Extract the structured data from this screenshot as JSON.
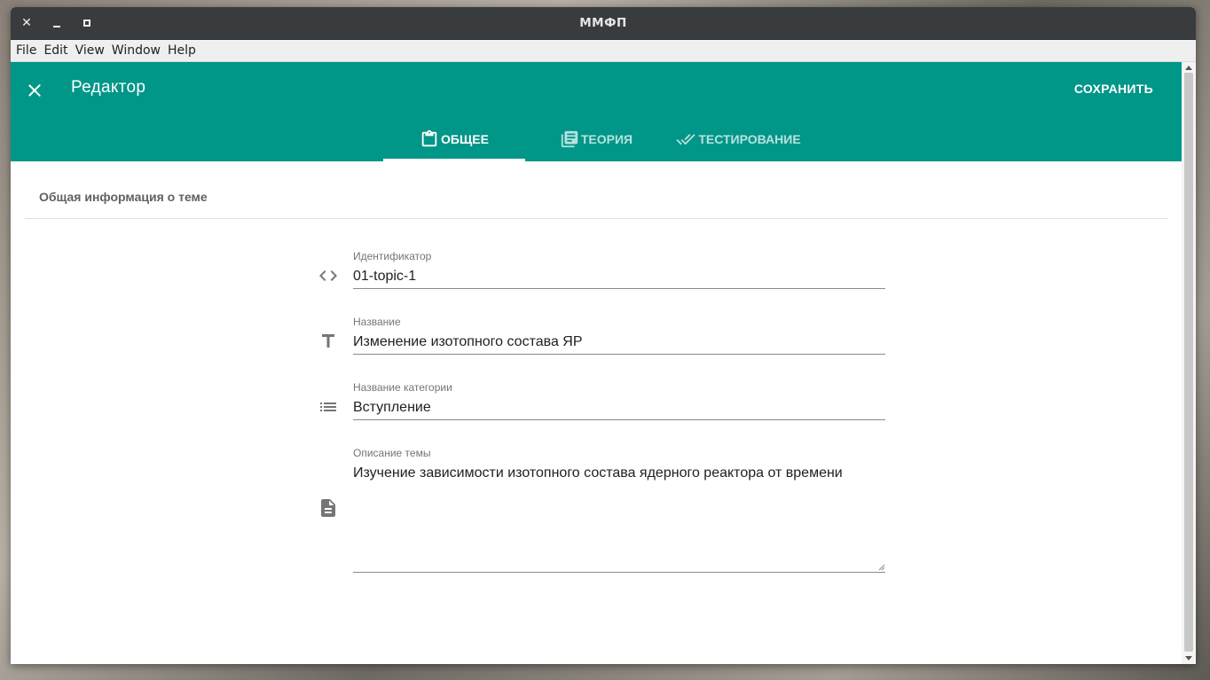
{
  "window": {
    "title": "ММФП"
  },
  "menubar": {
    "items": [
      "File",
      "Edit",
      "View",
      "Window",
      "Help"
    ]
  },
  "appbar": {
    "title": "Редактор",
    "save_label": "СОХРАНИТЬ",
    "close_icon": "close-icon",
    "color": "#009688"
  },
  "tabs": [
    {
      "label": "ОБЩЕЕ",
      "icon": "clipboard-icon",
      "active": true
    },
    {
      "label": "ТЕОРИЯ",
      "icon": "book-icon",
      "active": false
    },
    {
      "label": "ТЕСТИРОВАНИЕ",
      "icon": "double-check-icon",
      "active": false
    }
  ],
  "section": {
    "title": "Общая информация о теме"
  },
  "form": {
    "identifier": {
      "label": "Идентификатор",
      "value": "01-topic-1",
      "icon": "code-icon"
    },
    "name": {
      "label": "Название",
      "value": "Изменение изотопного состава ЯР",
      "icon": "text-icon"
    },
    "category": {
      "label": "Название категории",
      "value": "Вступление",
      "icon": "list-icon"
    },
    "description": {
      "label": "Описание темы",
      "value": "Изучение зависимости изотопного состава ядерного реактора от времени",
      "icon": "document-icon"
    }
  }
}
